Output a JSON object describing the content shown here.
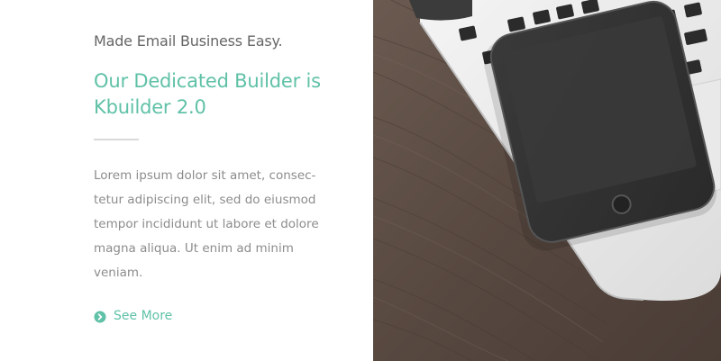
{
  "promo": {
    "kicker": "Made Email Business Easy.",
    "headline": "Our Dedicated Builder is Kbuilder 2.0",
    "body": "Lorem ipsum dolor sit amet, consec-\ntetur adipiscing elit, sed do eiusmod\ntempor incididunt ut labore et dolore\nmagna aliqua. Ut enim ad minim\nveniam.",
    "link_label": "See More",
    "link_icon": "chevron-circle-right-icon"
  },
  "colors": {
    "accent": "#5fc1a7",
    "heading_text": "#666666",
    "body_text": "#8c8c8c",
    "divider": "#d9d9d9",
    "wood": "#5a4b42"
  },
  "photo": {
    "subject": "laptop-and-smartphone-on-wooden-desk"
  }
}
